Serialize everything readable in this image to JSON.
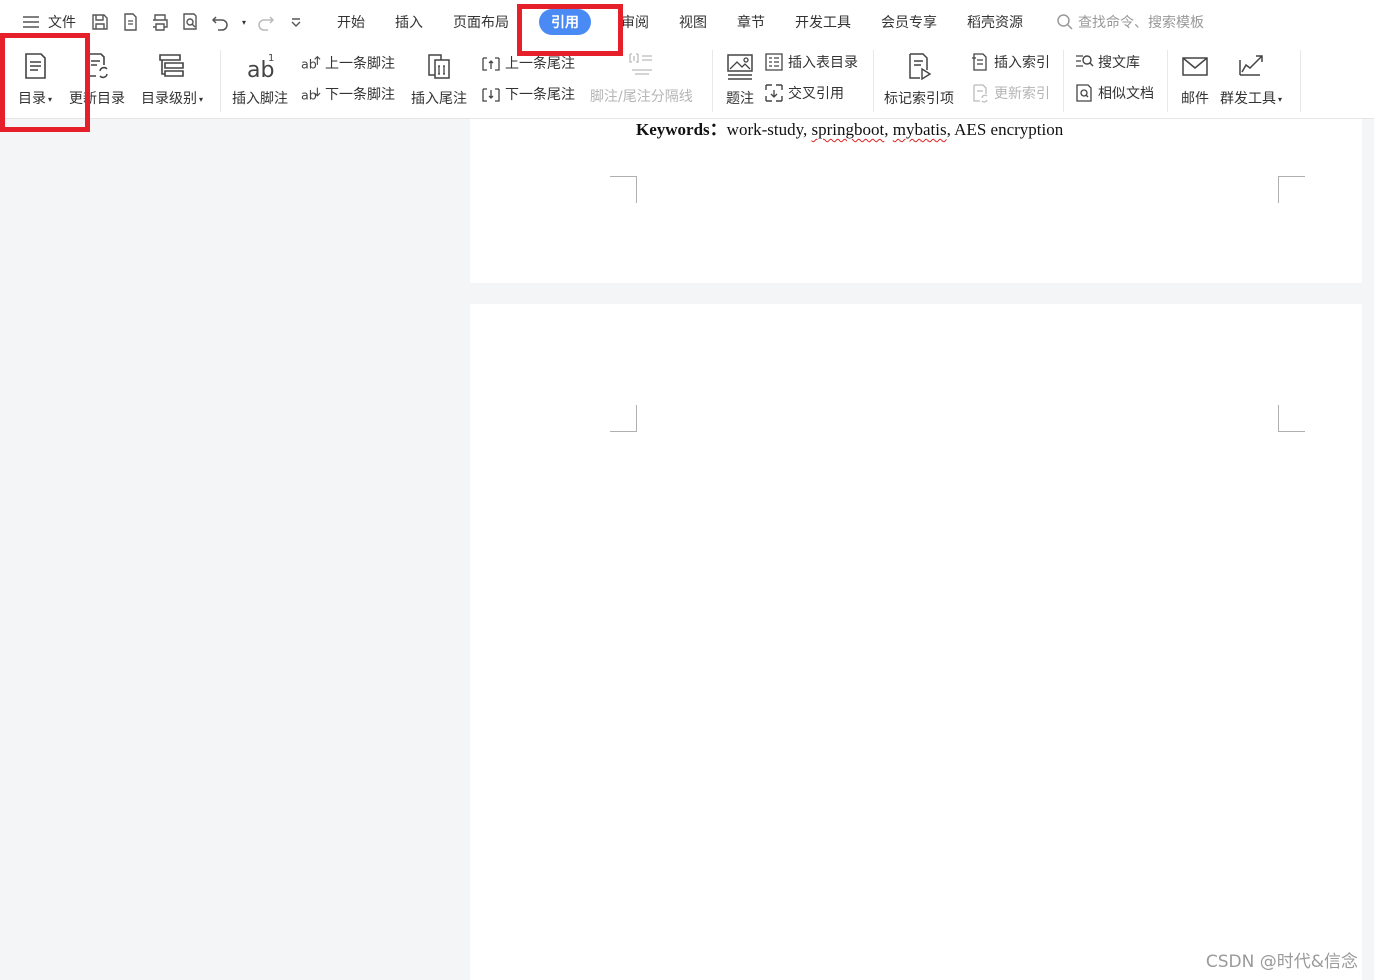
{
  "menubar": {
    "file_label": "文件",
    "tabs": [
      "开始",
      "插入",
      "页面布局",
      "引用",
      "审阅",
      "视图",
      "章节",
      "开发工具",
      "会员专享",
      "稻壳资源"
    ],
    "active_tab": "引用",
    "search_placeholder": "查找命令、搜索模板"
  },
  "ribbon": {
    "toc": "目录",
    "update_toc": "更新目录",
    "toc_level": "目录级别",
    "insert_footnote": "插入脚注",
    "prev_footnote": "上一条脚注",
    "next_footnote": "下一条脚注",
    "insert_endnote": "插入尾注",
    "prev_endnote": "上一条尾注",
    "next_endnote": "下一条尾注",
    "footnote_separator": "脚注/尾注分隔线",
    "caption": "题注",
    "insert_table_of_figures": "插入表目录",
    "cross_reference": "交叉引用",
    "mark_index_entry": "标记索引项",
    "insert_index": "插入索引",
    "update_index": "更新索引",
    "search_library": "搜文库",
    "similar_docs": "相似文档",
    "mail": "邮件",
    "mass_send_tool": "群发工具"
  },
  "document": {
    "keywords_label": "Keywords：",
    "keywords_pre": "work-study, ",
    "kw_springboot": "springboot",
    "kw_sep1": ", ",
    "kw_mybatis": "mybatis",
    "kw_post": ", AES encryption"
  },
  "watermark": "CSDN @时代&信念",
  "colors": {
    "accent": "#4a8af4",
    "highlight": "#e5202a"
  }
}
